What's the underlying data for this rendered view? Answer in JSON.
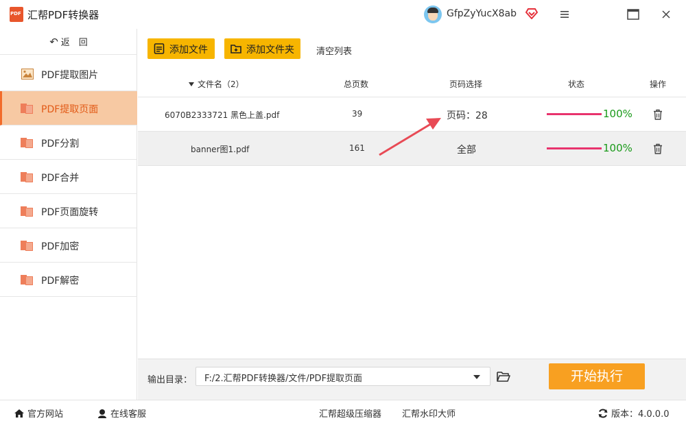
{
  "app": {
    "title": "汇帮PDF转换器",
    "username": "GfpZyYucX8ab"
  },
  "sidebar": {
    "back_label": "返　回",
    "items": [
      {
        "label": "PDF提取图片",
        "icon": "image-icon"
      },
      {
        "label": "PDF提取页面",
        "icon": "pdf-icon",
        "active": true
      },
      {
        "label": "PDF分割",
        "icon": "pdf-icon"
      },
      {
        "label": "PDF合并",
        "icon": "pdf-icon"
      },
      {
        "label": "PDF页面旋转",
        "icon": "pdf-icon"
      },
      {
        "label": "PDF加密",
        "icon": "pdf-icon"
      },
      {
        "label": "PDF解密",
        "icon": "pdf-icon"
      }
    ]
  },
  "toolbar": {
    "add_file": "添加文件",
    "add_folder": "添加文件夹",
    "clear_list": "清空列表"
  },
  "table": {
    "headers": {
      "filename": "文件名（2）",
      "total_pages": "总页数",
      "page_select": "页码选择",
      "status": "状态",
      "action": "操作"
    },
    "rows": [
      {
        "filename": "6070B2333721 黑色上盖.pdf",
        "pages": "39",
        "selection": "页码：28",
        "progress": "100%"
      },
      {
        "filename": "banner图1.pdf",
        "pages": "161",
        "selection": "全部",
        "progress": "100%"
      }
    ]
  },
  "output": {
    "label": "输出目录：",
    "path": "F:/2.汇帮PDF转换器/文件/PDF提取页面",
    "start_label": "开始执行"
  },
  "footer": {
    "website": "官方网站",
    "service": "在线客服",
    "compressor": "汇帮超级压缩器",
    "watermark": "汇帮水印大师",
    "version": "版本：4.0.0.0"
  },
  "colors": {
    "accent": "#f7b500",
    "active_bg": "#f7c9a3",
    "active_text": "#e25a17",
    "progress": "#e8336d",
    "percent": "#1a9a1a",
    "start": "#f8a021"
  }
}
